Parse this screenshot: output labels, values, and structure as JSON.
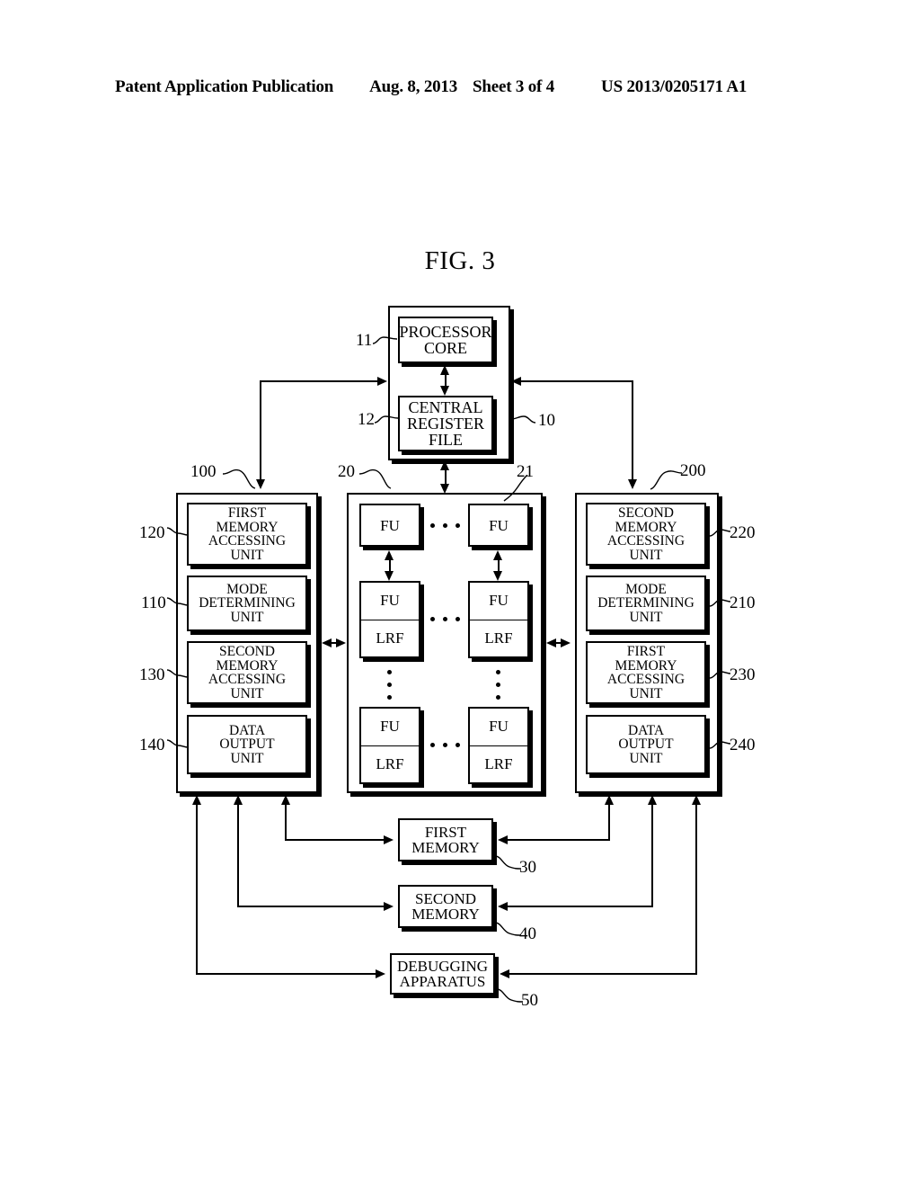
{
  "header": {
    "publication": "Patent Application Publication",
    "date": "Aug. 8, 2013",
    "sheet": "Sheet 3 of 4",
    "number": "US 2013/0205171 A1"
  },
  "figure": {
    "title": "FIG. 3"
  },
  "blocks": {
    "processor_core": "PROCESSOR\nCORE",
    "central_register_file": "CENTRAL\nREGISTER\nFILE",
    "left_first_memory_accessing": "FIRST\nMEMORY\nACCESSING\nUNIT",
    "left_mode_determining": "MODE\nDETERMINING\nUNIT",
    "left_second_memory_accessing": "SECOND\nMEMORY\nACCESSING\nUNIT",
    "left_data_output": "DATA\nOUTPUT\nUNIT",
    "right_second_memory_accessing": "SECOND\nMEMORY\nACCESSING\nUNIT",
    "right_mode_determining": "MODE\nDETERMINING\nUNIT",
    "right_first_memory_accessing": "FIRST\nMEMORY\nACCESSING\nUNIT",
    "right_data_output": "DATA\nOUTPUT\nUNIT",
    "first_memory": "FIRST\nMEMORY",
    "second_memory": "SECOND\nMEMORY",
    "debugging_apparatus": "DEBUGGING\nAPPARATUS",
    "fu": "FU",
    "lrf": "LRF"
  },
  "refs": {
    "processor_core": "11",
    "central_register_file": "12",
    "processor_block": "10",
    "left_unit": "100",
    "left_first_memory_accessing": "120",
    "left_mode_determining": "110",
    "left_second_memory_accessing": "130",
    "left_data_output": "140",
    "fu_array": "20",
    "fu_single": "21",
    "right_unit": "200",
    "right_second_memory_accessing": "220",
    "right_mode_determining": "210",
    "right_first_memory_accessing": "230",
    "right_data_output": "240",
    "first_memory": "30",
    "second_memory": "40",
    "debugging_apparatus": "50"
  }
}
